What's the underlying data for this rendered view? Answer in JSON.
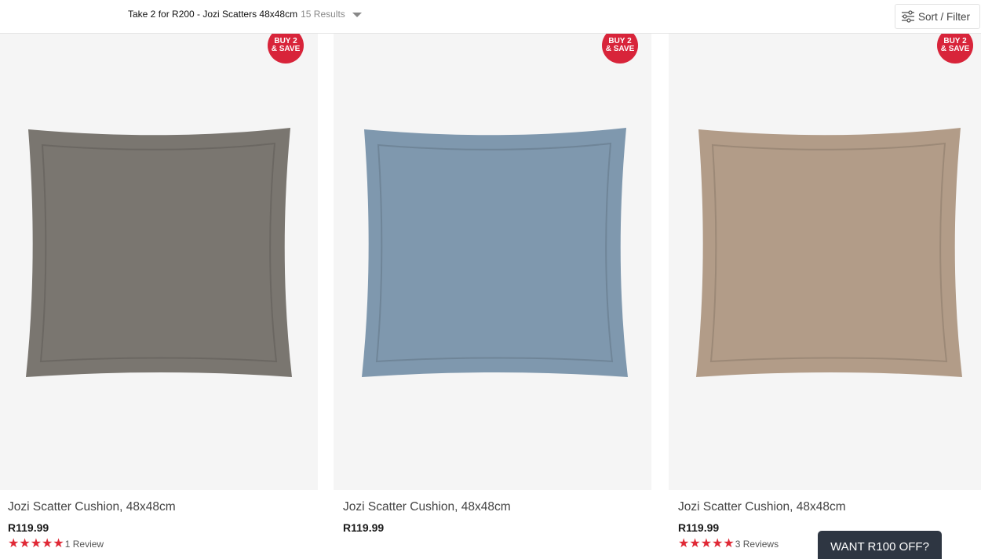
{
  "header": {
    "breadcrumb_title": "Take 2 for R200 - Jozi Scatters 48x48cm",
    "results_count": "15 Results",
    "sort_filter_label": "Sort / Filter"
  },
  "products": [
    {
      "badge_line1": "BUY 2",
      "badge_line2": "& SAVE",
      "title": "Jozi Scatter Cushion, 48x48cm",
      "price": "R119.99",
      "rating": 5,
      "reviews_label": "1 Review",
      "color": "#7a7670"
    },
    {
      "badge_line1": "BUY 2",
      "badge_line2": "& SAVE",
      "title": "Jozi Scatter Cushion, 48x48cm",
      "price": "R119.99",
      "rating": null,
      "reviews_label": "",
      "color": "#7f98ae"
    },
    {
      "badge_line1": "BUY 2",
      "badge_line2": "& SAVE",
      "title": "Jozi Scatter Cushion, 48x48cm",
      "price": "R119.99",
      "rating": 5,
      "reviews_label": "3 Reviews",
      "color": "#b29c88"
    }
  ],
  "promo": {
    "label": "WANT R100 OFF?"
  },
  "colors": {
    "badge": "#d8243a",
    "star": "#e02936",
    "promo_bg": "#2e3642"
  }
}
